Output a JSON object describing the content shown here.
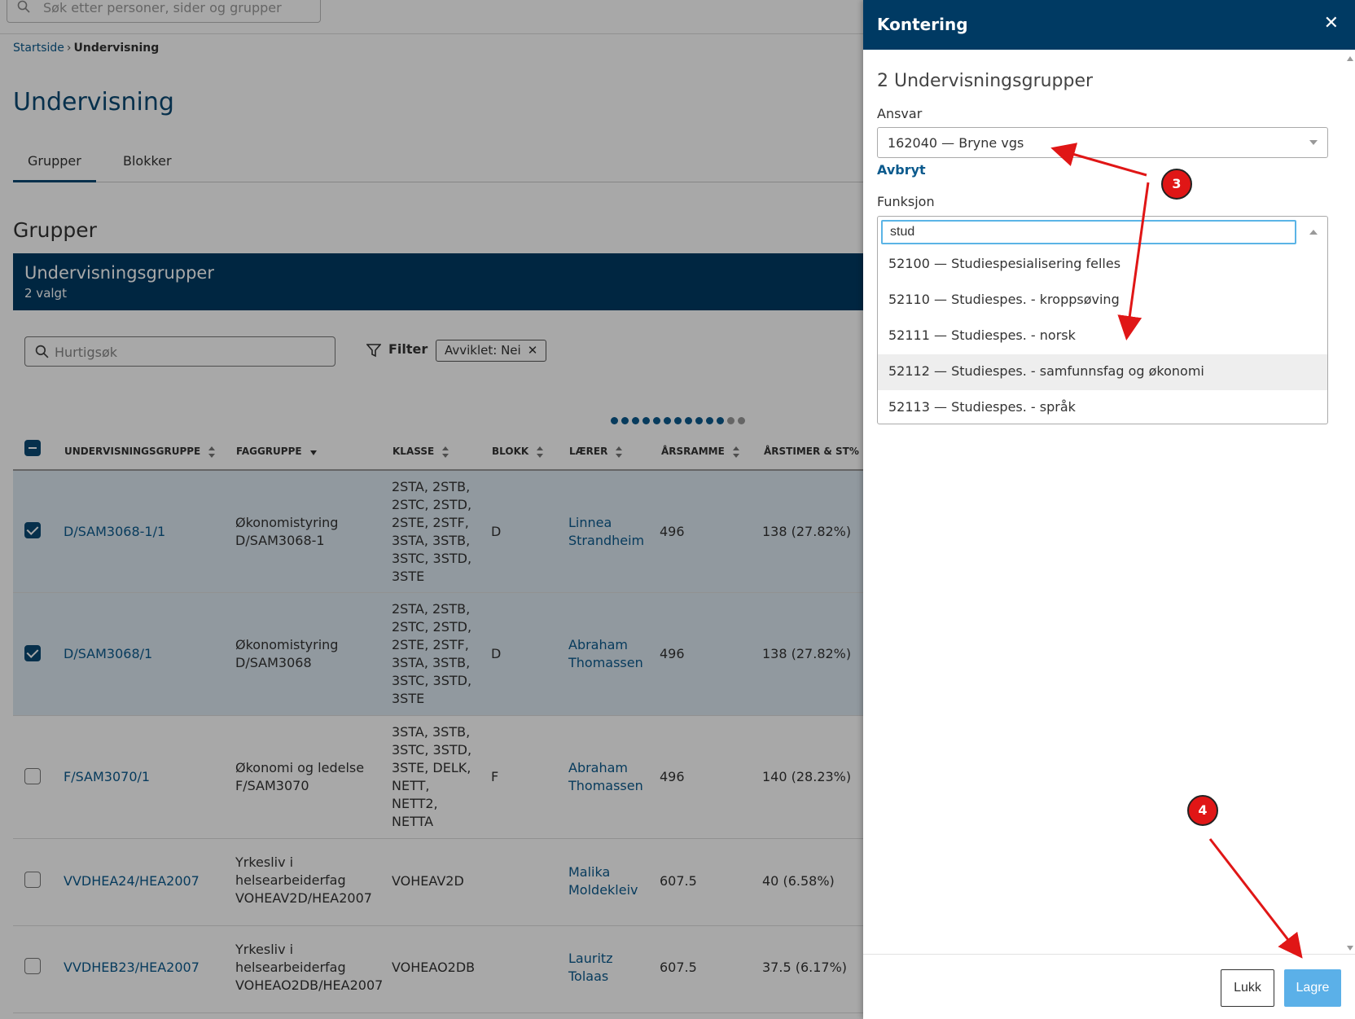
{
  "global_search": {
    "placeholder": "Søk etter personer, sider og grupper"
  },
  "breadcrumb": {
    "home": "Startside",
    "current": "Undervisning"
  },
  "page": {
    "title": "Undervisning"
  },
  "tabs": [
    {
      "label": "Grupper",
      "active": true
    },
    {
      "label": "Blokker",
      "active": false
    }
  ],
  "section": {
    "title": "Grupper"
  },
  "group_panel": {
    "title": "Undervisningsgrupper",
    "subtitle": "2 valgt"
  },
  "toolbar": {
    "quicksearch_placeholder": "Hurtigsøk",
    "filter_label": "Filter",
    "chip_label": "Avviklet: Nei"
  },
  "table": {
    "headers": [
      "UNDERVISNINGSGRUPPE",
      "FAGGRUPPE",
      "KLASSE",
      "BLOKK",
      "LÆRER",
      "ÅRSRAMME",
      "ÅRSTIMER & ST%"
    ],
    "rows": [
      {
        "checked": true,
        "gruppe": "D/SAM3068-1/1",
        "fag": [
          "Økonomistyring",
          "D/SAM3068-1"
        ],
        "klasse": [
          "2STA, 2STB,",
          "2STC, 2STD,",
          "2STE, 2STF,",
          "3STA, 3STB,",
          "3STC, 3STD,",
          "3STE"
        ],
        "blokk": "D",
        "laerer": [
          "Linnea",
          "Strandheim"
        ],
        "arsramme": "496",
        "arstimer": "138 (27.82%)"
      },
      {
        "checked": true,
        "gruppe": "D/SAM3068/1",
        "fag": [
          "Økonomistyring",
          "D/SAM3068"
        ],
        "klasse": [
          "2STA, 2STB,",
          "2STC, 2STD,",
          "2STE, 2STF,",
          "3STA, 3STB,",
          "3STC, 3STD,",
          "3STE"
        ],
        "blokk": "D",
        "laerer": [
          "Abraham",
          "Thomassen"
        ],
        "arsramme": "496",
        "arstimer": "138 (27.82%)"
      },
      {
        "checked": false,
        "gruppe": "F/SAM3070/1",
        "fag": [
          "Økonomi og ledelse",
          "F/SAM3070"
        ],
        "klasse": [
          "3STA, 3STB,",
          "3STC, 3STD,",
          "3STE, DELK,",
          "NETT,",
          "NETT2,",
          "NETTA"
        ],
        "blokk": "F",
        "laerer": [
          "Abraham",
          "Thomassen"
        ],
        "arsramme": "496",
        "arstimer": "140 (28.23%)"
      },
      {
        "checked": false,
        "gruppe": "VVDHEA24/HEA2007",
        "fag": [
          "Yrkesliv i",
          "helsearbeiderfag",
          "VOHEAV2D/HEA2007"
        ],
        "klasse": [
          "VOHEAV2D"
        ],
        "blokk": "",
        "laerer": [
          "Malika",
          "Moldekleiv"
        ],
        "arsramme": "607.5",
        "arstimer": "40 (6.58%)"
      },
      {
        "checked": false,
        "gruppe": "VVDHEB23/HEA2007",
        "fag": [
          "Yrkesliv i",
          "helsearbeiderfag",
          "VOHEAO2DB/HEA2007"
        ],
        "klasse": [
          "VOHEAO2DB"
        ],
        "blokk": "",
        "laerer": [
          "Lauritz",
          "Tolaas"
        ],
        "arsramme": "607.5",
        "arstimer": "37.5 (6.17%)"
      }
    ]
  },
  "drawer": {
    "title": "Kontering",
    "close_symbol": "✕",
    "subtitle": "2 Undervisningsgrupper",
    "ansvar_label": "Ansvar",
    "ansvar_value": "162040 — Bryne vgs",
    "cancel_link": "Avbryt",
    "funksjon_label": "Funksjon",
    "funksjon_input": "stud",
    "options": [
      "52100 — Studiespesialisering felles",
      "52110 — Studiespes. - kroppsøving",
      "52111 — Studiespes. - norsk",
      "52112 — Studiespes. - samfunnsfag og økonomi",
      "52113 — Studiespes. - språk"
    ],
    "highlighted_option": 3,
    "btn_close": "Lukk",
    "btn_save": "Lagre"
  },
  "annotations": {
    "badge_3": "3",
    "badge_4": "4",
    "color": "#e01616"
  }
}
